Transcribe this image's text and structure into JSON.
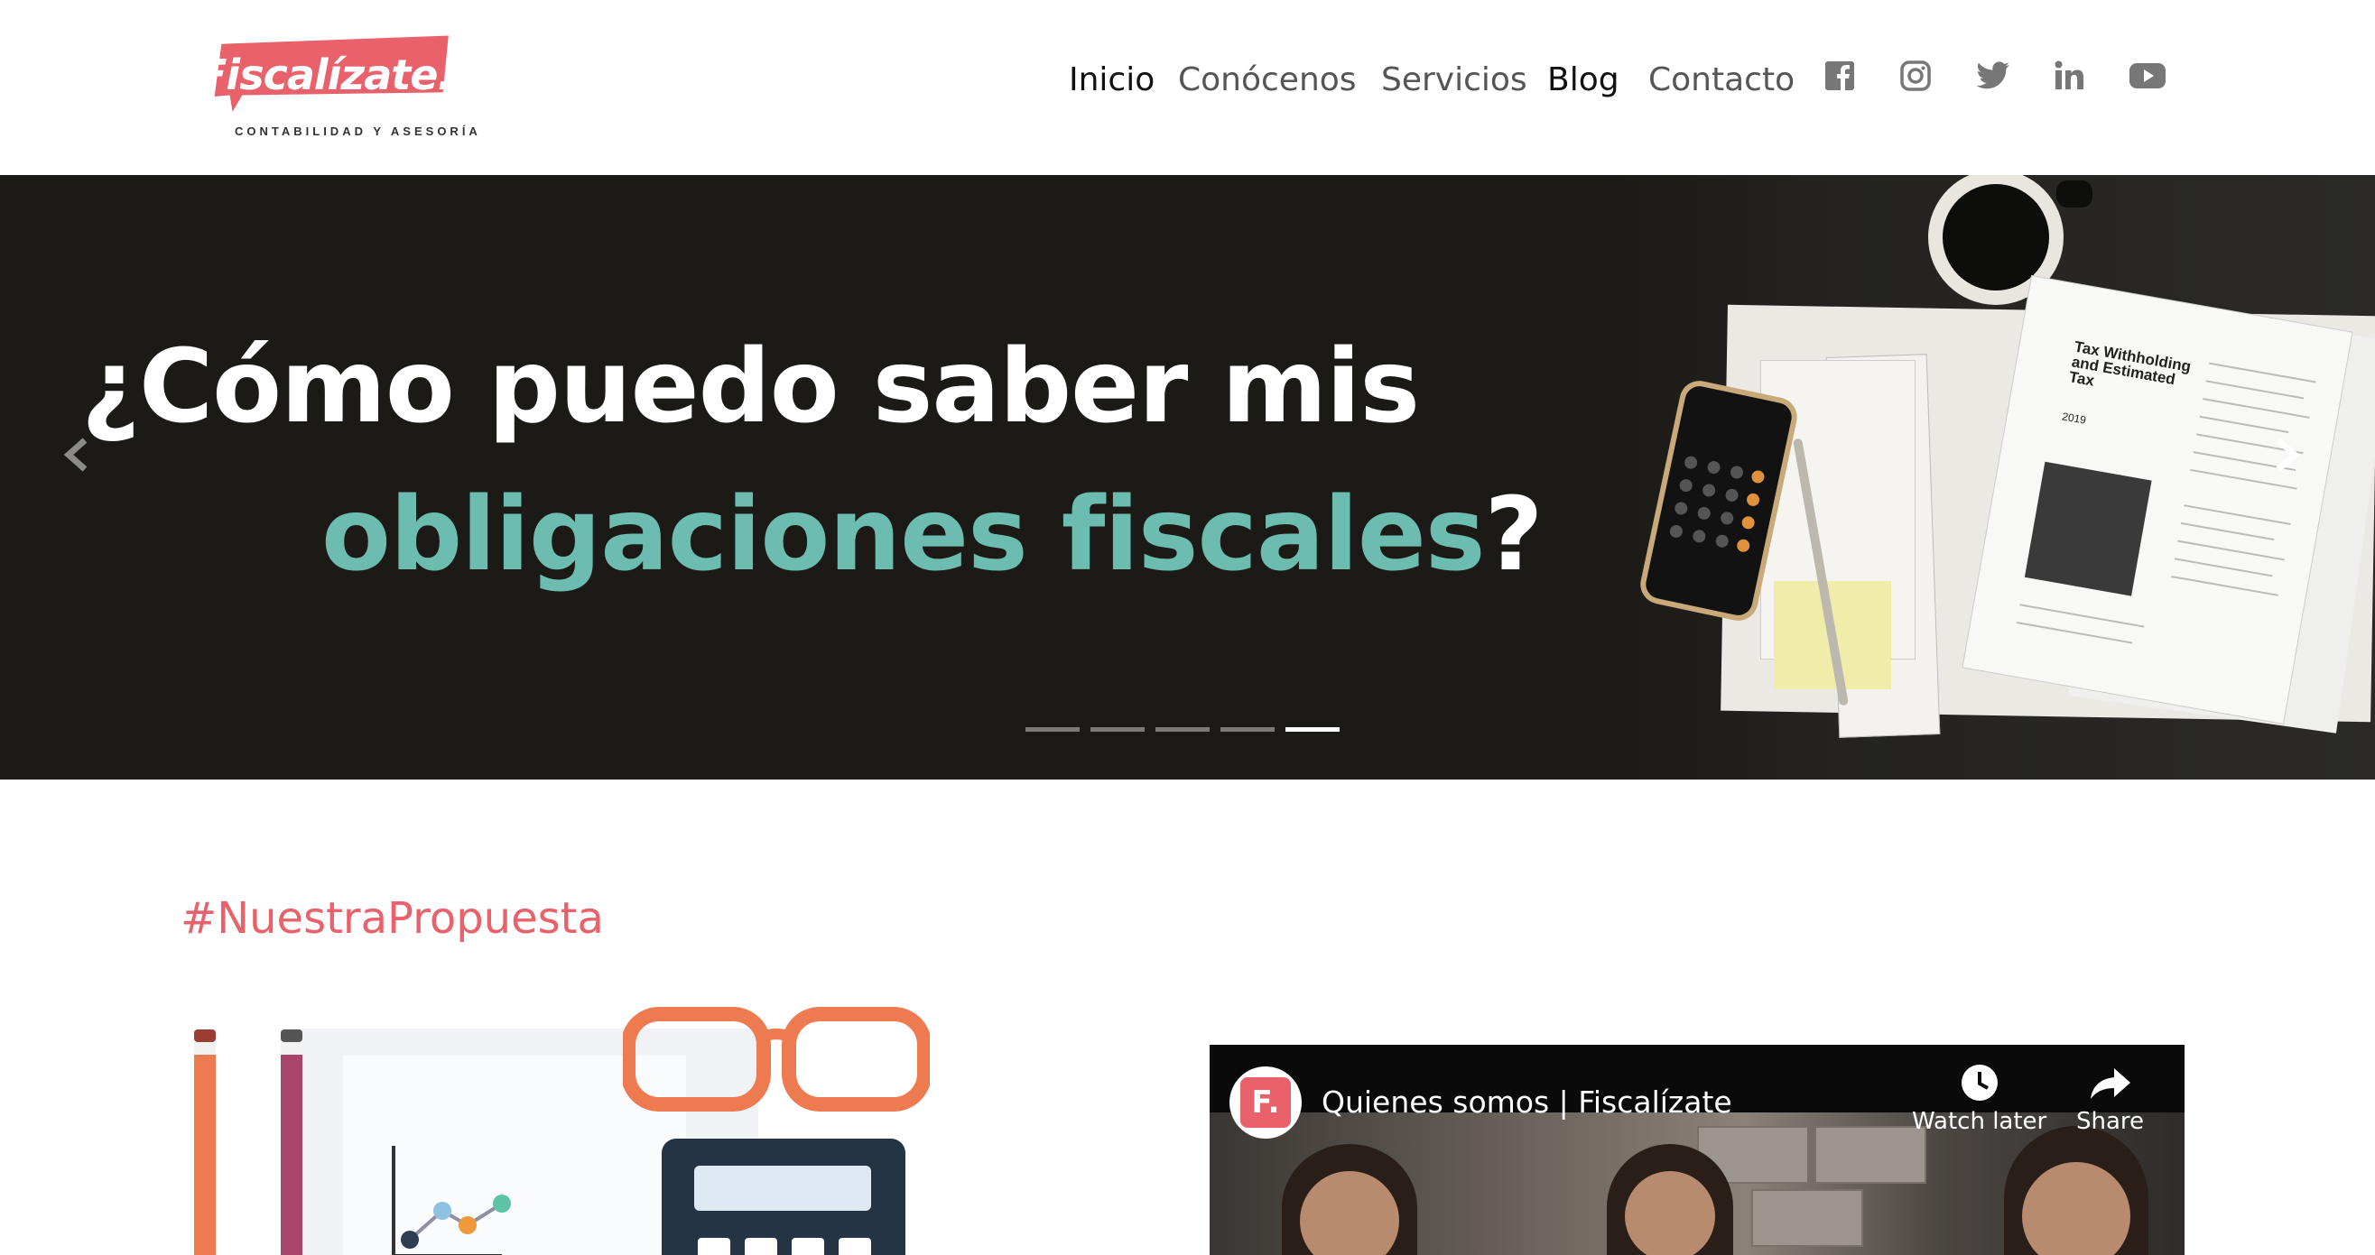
{
  "brand": {
    "name": "Fiscalízate.",
    "tagline": "CONTABILIDAD Y ASESORÍA",
    "color": "#e9616a"
  },
  "nav": {
    "items": [
      {
        "label": "Inicio",
        "active": true
      },
      {
        "label": "Conócenos",
        "active": false
      },
      {
        "label": "Servicios",
        "active": false
      },
      {
        "label": "Blog",
        "active": true
      },
      {
        "label": "Contacto",
        "active": false
      }
    ],
    "social_icons": [
      "facebook-icon",
      "instagram-icon",
      "twitter-icon",
      "linkedin-icon",
      "youtube-icon"
    ]
  },
  "hero": {
    "title_line1": "¿Cómo puedo saber mis",
    "title_line2_highlight": "obligaciones fiscales",
    "title_line2_end": "?",
    "highlight_color": "#6cbcb0",
    "slide_count": 5,
    "active_slide": 5,
    "prev_icon": "chevron-left-icon",
    "next_icon": "chevron-right-icon",
    "form_title": "Tax Withholding and Estimated Tax",
    "form_year": "2019"
  },
  "section": {
    "hashtag": "#NuestraPropuesta"
  },
  "video": {
    "title": "Quienes somos | Fiscalízate",
    "channel_initial": "F.",
    "watch_later": "Watch later",
    "share": "Share"
  }
}
